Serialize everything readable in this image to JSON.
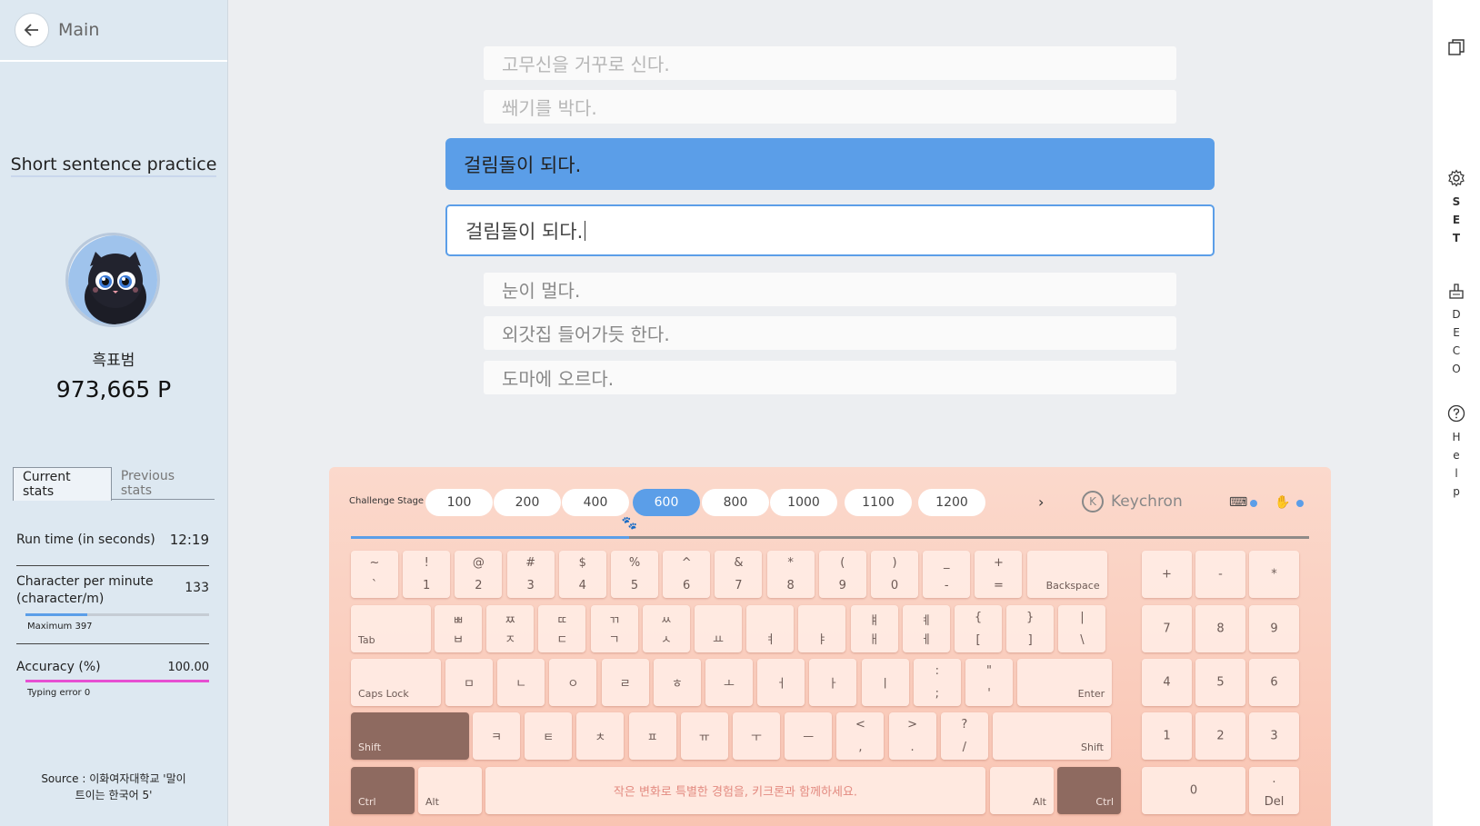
{
  "sidebar": {
    "back_label": "Main",
    "mode_title": "Short sentence practice",
    "username": "흑표범",
    "points": "973,665 P",
    "tabs": [
      "Current stats",
      "Previous stats"
    ],
    "stats": {
      "runtime_label": "Run time (in seconds)",
      "runtime_value": "12:19",
      "cpm_label": "Character per minute (character/m)",
      "cpm_value": "133",
      "cpm_max_note": "Maximum 397",
      "cpm_fraction": 0.335,
      "accuracy_label": "Accuracy (%)",
      "accuracy_value": "100.00",
      "typing_error_note": "Typing error 0",
      "accuracy_fraction": 1.0
    },
    "source": "Source : 이화여자대학교 '말이 트이는 한국어 5'",
    "colors": {
      "cpm_bar": "#5b9ee8",
      "accuracy_bar": "#e64fd2"
    }
  },
  "sentences": {
    "previous": [
      "고무신을 거꾸로 신다.",
      "쐐기를 박다."
    ],
    "current": "걸림돌이 되다.",
    "typed": "걸림돌이 되다.",
    "next": [
      "눈이 멀다.",
      "외갓집 들어가듯 한다.",
      "도마에 오르다."
    ]
  },
  "keyboard": {
    "stage_label": "Challenge Stage",
    "stages": [
      "100",
      "200",
      "400",
      "600",
      "800",
      "1000",
      "1100",
      "1200"
    ],
    "active_stage": "600",
    "brand": "Keychron",
    "progress_fraction": 0.29,
    "space_text": "작은 변화로 특별한 경험을, 키크론과 함께하세요.",
    "row1": [
      {
        "t": "~",
        "b": "`"
      },
      {
        "t": "!",
        "b": "1"
      },
      {
        "t": "@",
        "b": "2"
      },
      {
        "t": "#",
        "b": "3"
      },
      {
        "t": "$",
        "b": "4"
      },
      {
        "t": "%",
        "b": "5"
      },
      {
        "t": "^",
        "b": "6"
      },
      {
        "t": "&",
        "b": "7"
      },
      {
        "t": "*",
        "b": "8"
      },
      {
        "t": "(",
        "b": "9"
      },
      {
        "t": ")",
        "b": "0"
      },
      {
        "t": "_",
        "b": "-"
      },
      {
        "t": "+",
        "b": "="
      }
    ],
    "row2": [
      {
        "t": "ㅃ",
        "b": "ㅂ"
      },
      {
        "t": "ㅉ",
        "b": "ㅈ"
      },
      {
        "t": "ㄸ",
        "b": "ㄷ"
      },
      {
        "t": "ㄲ",
        "b": "ㄱ"
      },
      {
        "t": "ㅆ",
        "b": "ㅅ"
      },
      {
        "t": "",
        "b": "ㅛ"
      },
      {
        "t": "",
        "b": "ㅕ"
      },
      {
        "t": "",
        "b": "ㅑ"
      },
      {
        "t": "ㅒ",
        "b": "ㅐ"
      },
      {
        "t": "ㅖ",
        "b": "ㅔ"
      },
      {
        "t": "{",
        "b": "["
      },
      {
        "t": "}",
        "b": "]"
      },
      {
        "t": "|",
        "b": "\\"
      }
    ],
    "row3": [
      {
        "t": "",
        "b": "ㅁ"
      },
      {
        "t": "",
        "b": "ㄴ"
      },
      {
        "t": "",
        "b": "ㅇ"
      },
      {
        "t": "",
        "b": "ㄹ"
      },
      {
        "t": "",
        "b": "ㅎ"
      },
      {
        "t": "",
        "b": "ㅗ"
      },
      {
        "t": "",
        "b": "ㅓ"
      },
      {
        "t": "",
        "b": "ㅏ"
      },
      {
        "t": "",
        "b": "ㅣ"
      },
      {
        "t": ":",
        "b": ";"
      },
      {
        "t": "\"",
        "b": "'"
      }
    ],
    "row4": [
      {
        "t": "",
        "b": "ㅋ"
      },
      {
        "t": "",
        "b": "ㅌ"
      },
      {
        "t": "",
        "b": "ㅊ"
      },
      {
        "t": "",
        "b": "ㅍ"
      },
      {
        "t": "",
        "b": "ㅠ"
      },
      {
        "t": "",
        "b": "ㅜ"
      },
      {
        "t": "",
        "b": "ㅡ"
      },
      {
        "t": "<",
        "b": ","
      },
      {
        "t": ">",
        "b": "."
      },
      {
        "t": "?",
        "b": "/"
      }
    ],
    "mods": {
      "backspace": "Backspace",
      "tab": "Tab",
      "caps": "Caps Lock",
      "enter": "Enter",
      "shift_l": "Shift",
      "shift_r": "Shift",
      "ctrl_l": "Ctrl",
      "alt_l": "Alt",
      "alt_r": "Alt",
      "ctrl_r": "Ctrl"
    },
    "numpad": {
      "row1": [
        "+",
        "-",
        "*"
      ],
      "row2": [
        "7",
        "8",
        "9"
      ],
      "row3": [
        "4",
        "5",
        "6"
      ],
      "row4": [
        "1",
        "2",
        "3"
      ],
      "zero": "0",
      "del_top": ".",
      "del": "Del"
    }
  },
  "rail": {
    "set": "SET",
    "deco": "DECO",
    "help": "Help"
  }
}
